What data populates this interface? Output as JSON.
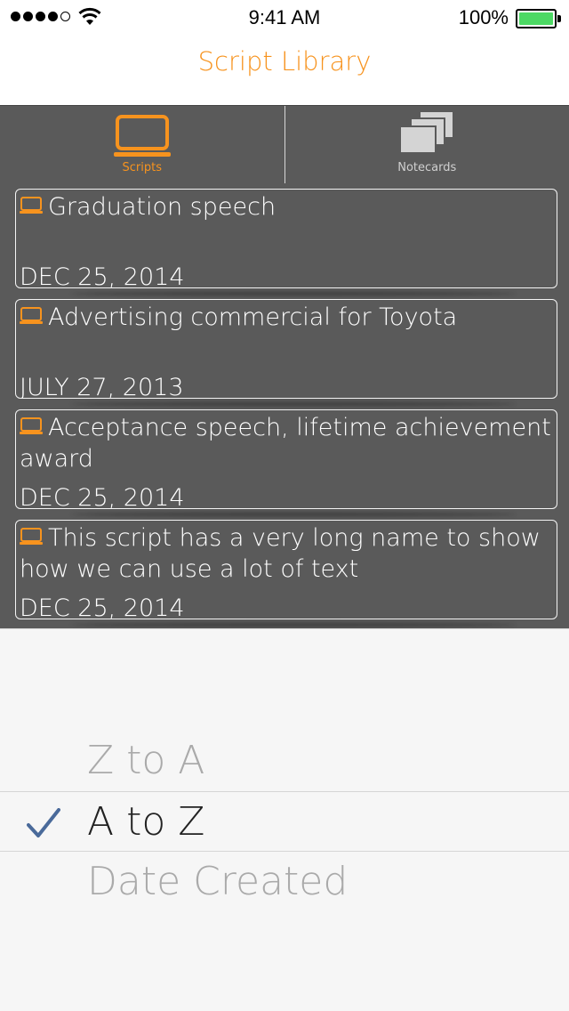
{
  "status_bar": {
    "time": "9:41 AM",
    "battery_percent": "100%",
    "signal_dots_filled": 4,
    "signal_dots_total": 5,
    "battery_level": 1.0,
    "battery_color": "#4cd964"
  },
  "nav": {
    "title": "Script Library",
    "accent_color": "#f7931e"
  },
  "tabs": [
    {
      "label": "Scripts",
      "icon": "laptop-icon",
      "active": true
    },
    {
      "label": "Notecards",
      "icon": "notecards-stack-icon",
      "active": false
    }
  ],
  "scripts": [
    {
      "title": "Graduation speech",
      "date": "DEC 25, 2014",
      "icon": "laptop-icon"
    },
    {
      "title": "Advertising commercial for Toyota",
      "date": "JULY 27, 2013",
      "icon": "laptop-icon"
    },
    {
      "title": "Acceptance speech, lifetime achievement award",
      "date": "DEC 25, 2014",
      "icon": "laptop-icon"
    },
    {
      "title": "This script has a very long name to show how we can use a lot of text",
      "date": "DEC 25, 2014",
      "icon": "laptop-icon"
    }
  ],
  "sort_picker": {
    "options": [
      "Z to A",
      "A to Z",
      "Date Created"
    ],
    "selected": "A to Z",
    "check_icon": "checkmark-icon",
    "check_color": "#4a6a9a"
  }
}
